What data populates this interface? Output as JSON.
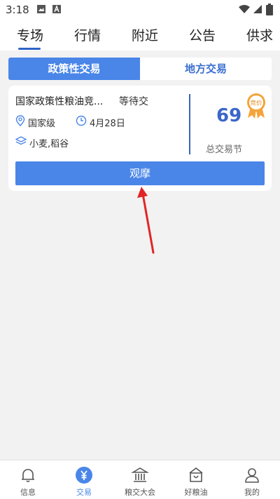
{
  "status_bar": {
    "time": "3:18"
  },
  "top_tabs": [
    "专场",
    "行情",
    "附近",
    "公告",
    "供求"
  ],
  "segments": {
    "left": "政策性交易",
    "right": "地方交易"
  },
  "card": {
    "title": "国家政策性粮油竞...",
    "status": "等待交",
    "level": "国家级",
    "date": "4月28日",
    "grains": "小麦,稻谷",
    "count": "69",
    "count_label": "总交易节",
    "badge_text": "竞价",
    "button_label": "观摩"
  },
  "bottom_nav": [
    "信息",
    "交易",
    "粮交大会",
    "好粮油",
    "我的"
  ],
  "colors": {
    "primary": "#4a86e8",
    "title_blue": "#3b66c9",
    "arrow": "#e12525",
    "badge": "#f4a43a"
  }
}
